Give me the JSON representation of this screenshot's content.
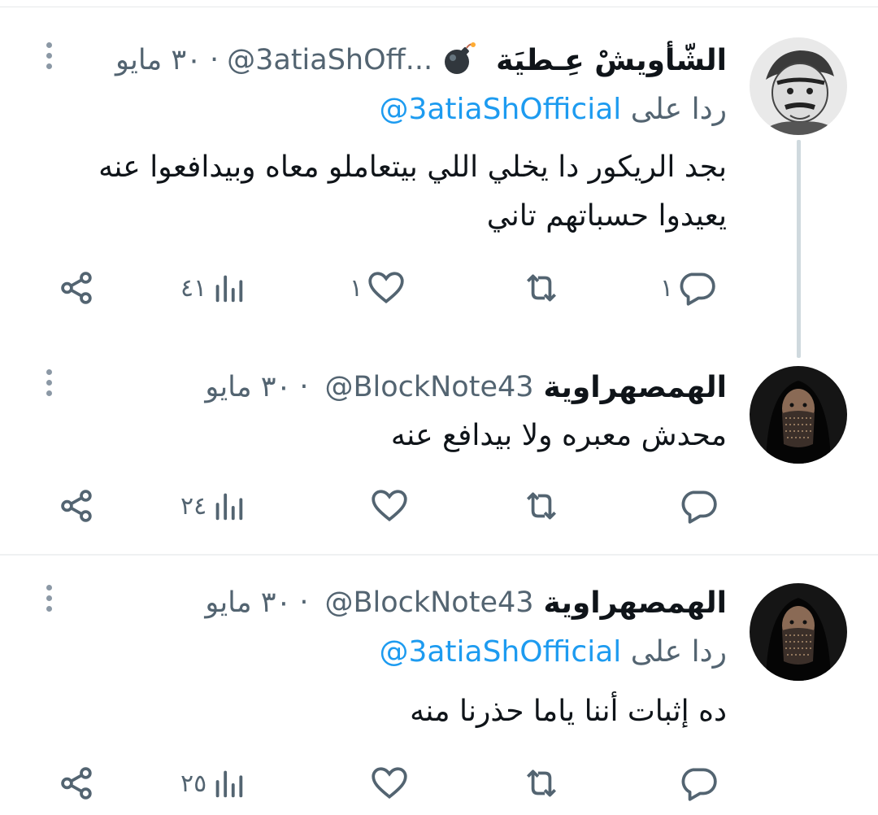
{
  "tweets": [
    {
      "name": "الشّأويشْ عِـطيَة",
      "badge_icon": "bomb-emoji",
      "handle": "@3atiaShOff...",
      "date": "۳۰ مايو",
      "reply_prefix": "ردا على",
      "reply_mention": "@3atiaShOfficial",
      "text_lines": [
        "بجد الريكور دا يخلي اللي بيتعاملو معاه وبيدافعوا عنه",
        "يعيدوا حسباتهم تاني"
      ],
      "replies": "۱",
      "retweets": "",
      "likes": "۱",
      "views": "٤١"
    },
    {
      "name": "الهمصهراوية",
      "handle": "@BlockNote43",
      "date": "۳۰ مايو",
      "text_lines": [
        "محدش معبره ولا بيدافع عنه"
      ],
      "replies": "",
      "retweets": "",
      "likes": "",
      "views": "٢٤"
    },
    {
      "name": "الهمصهراوية",
      "handle": "@BlockNote43",
      "date": "۳۰ مايو",
      "reply_prefix": "ردا على",
      "reply_mention": "@3atiaShOfficial",
      "text_lines": [
        "ده إثبات أننا ياما حذرنا منه"
      ],
      "replies": "",
      "retweets": "",
      "likes": "",
      "views": "٢٥"
    }
  ],
  "separator": "·",
  "colors": {
    "text": "#0f1419",
    "muted": "#536471",
    "link": "#1d9bf0",
    "thread": "#cfd9de"
  }
}
